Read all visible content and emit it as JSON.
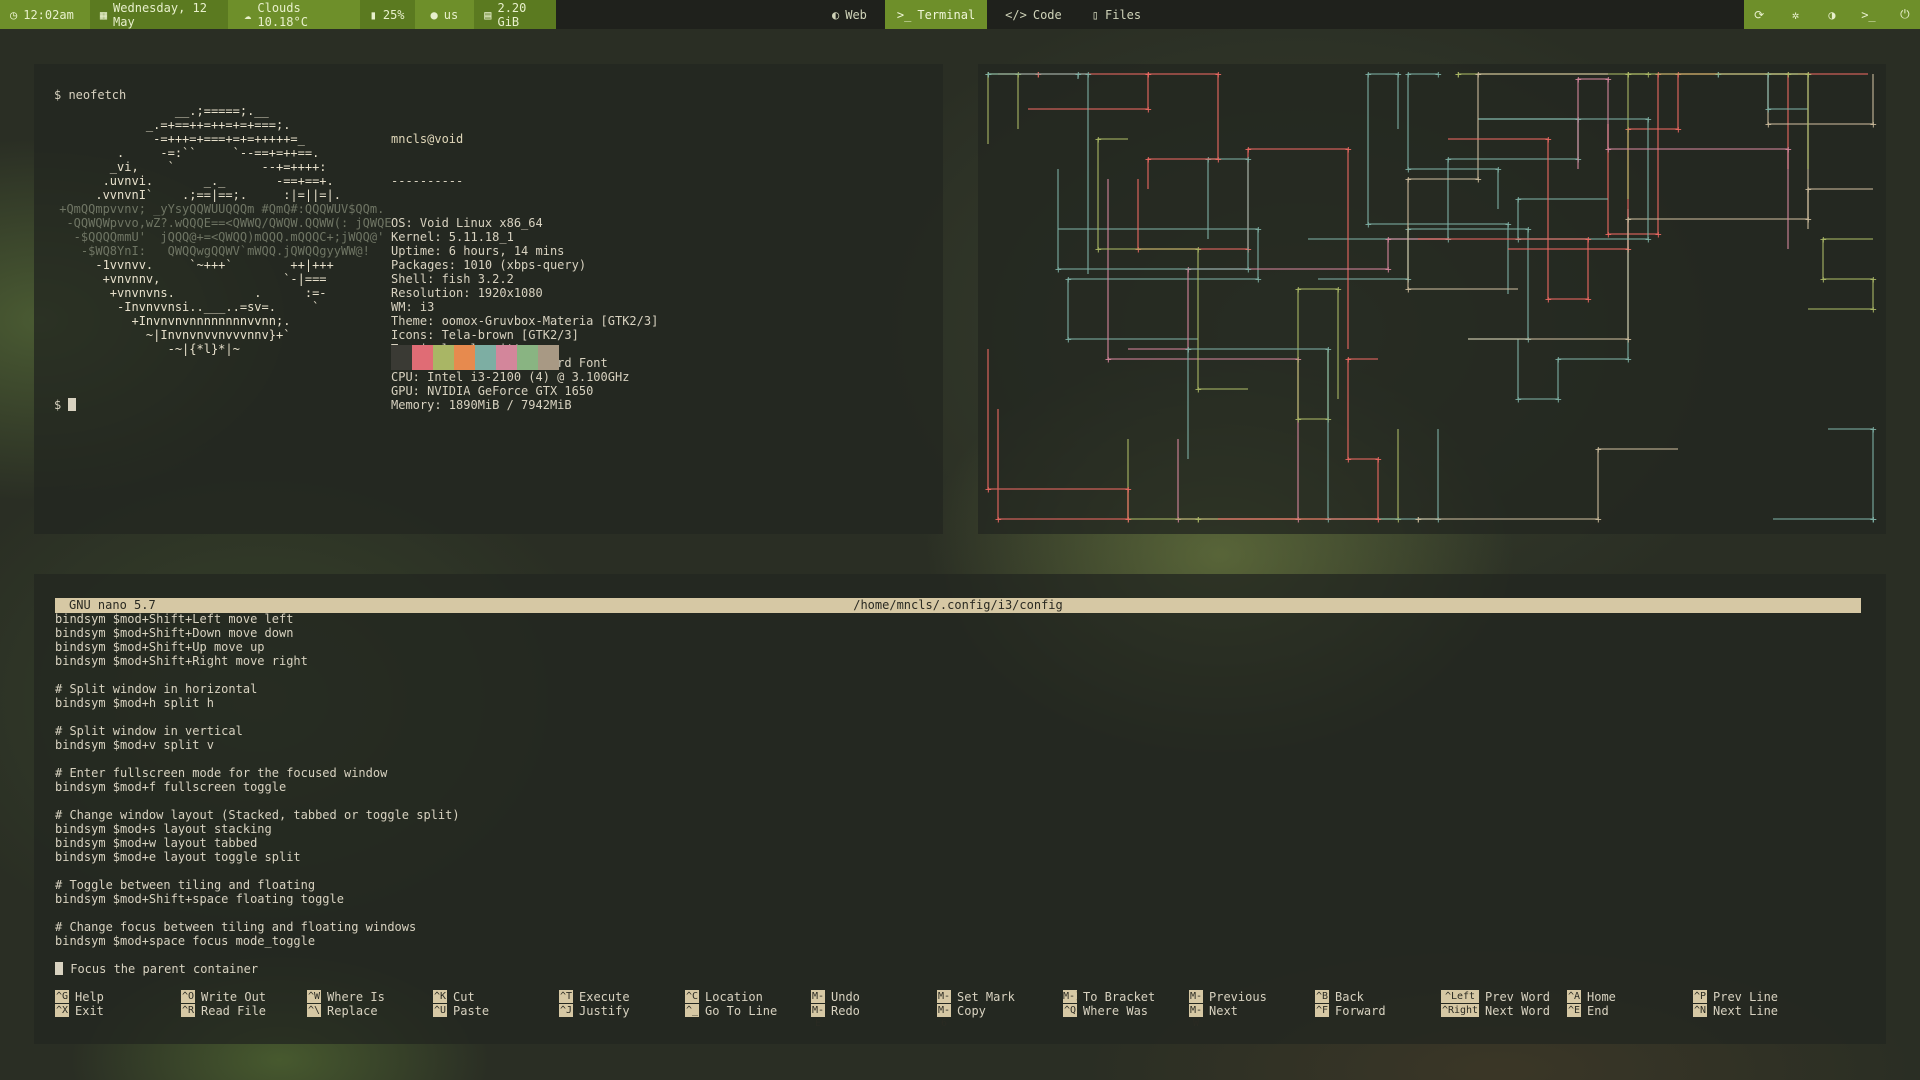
{
  "topbar": {
    "time": "12:02am",
    "date": "Wednesday, 12 May",
    "weather": "Clouds 10.18°C",
    "battery": "25%",
    "user": "us",
    "memory": "2.20 GiB",
    "workspaces": [
      {
        "label": "Web",
        "icon": "globe-icon",
        "active": false
      },
      {
        "label": "Terminal",
        "icon": "terminal-icon",
        "active": true
      },
      {
        "label": "Code",
        "icon": "code-icon",
        "active": false
      },
      {
        "label": "Files",
        "icon": "file-icon",
        "active": false
      }
    ],
    "right_icons": [
      "refresh-icon",
      "gear-icon",
      "theme-icon",
      "terminal-icon",
      "power-icon"
    ],
    "accent": "#6e8f2a"
  },
  "neofetch": {
    "prompt": "$ neofetch",
    "ascii": [
      "                 __.;=====;.__",
      "             _.=+==++=++=+=+===;.",
      "              -=+++=+===+=+=+++++=_",
      "         .     -=:``     `--==+=++==.",
      "        _vi,    `            --+=++++:",
      "       .uvnvi.       _._       -==+==+.",
      "      .vvnvnI`    .;==|==;.     :|=||=|.",
      " +QmQQmpvvnv; _yYsyQQWUUQQQm #QmQ#:QQQWUV$QQm.",
      "  -QQWQWpvvo,wZ?.wQQQE==<QWWQ/QWQW.QQWW(: jQWQE",
      "   -$QQQQmmU'  jQQQ@+=<QWQQ)mQQQ.mQQQC+;jWQQ@'",
      "    -$WQ8YnI:   QWQQwgQQWV`mWQQ.jQWQQgyyWW@!",
      "      -1vvnvv.     `~+++`        ++|+++",
      "       +vnvnnv,                 `-|===",
      "        +vnvnvns.           .      :=-",
      "         -Invnvvnsi..___..=sv=.     `",
      "           +Invnvnvnnnnnnnnvvnn;.",
      "             ~|Invnvnvvnvvvnnv}+`",
      "                -~|{*l}*|~"
    ],
    "ascii_dim_rows": [
      7,
      8,
      9,
      10
    ],
    "user_host": "mncls@void",
    "separator": "----------",
    "info": [
      "OS: Void Linux x86_64",
      "Kernel: 5.11.18_1",
      "Uptime: 6 hours, 14 mins",
      "Packages: 1010 (xbps-query)",
      "Shell: fish 3.2.2",
      "Resolution: 1920x1080",
      "WM: i3",
      "Theme: oomox-Gruvbox-Materia [GTK2/3]",
      "Icons: Tela-brown [GTK2/3]",
      "Terminal: alacritty",
      "Terminal Font: agave Nerd Font",
      "CPU: Intel i3-2100 (4) @ 3.100GHz",
      "GPU: NVIDIA GeForce GTX 1650",
      "Memory: 1890MiB / 7942MiB"
    ],
    "palette": [
      "#3a3a34",
      "#e06c75",
      "#a9b665",
      "#e78a4e",
      "#7daea3",
      "#d3869b",
      "#89b482",
      "#a89984"
    ],
    "prompt2": "$"
  },
  "pipes": {
    "colors": [
      "#ea6962",
      "#a9b665",
      "#7daea3",
      "#d3869b",
      "#c9b99a"
    ]
  },
  "nano": {
    "version": "GNU nano 5.7",
    "path": "/home/mncls/.config/i3/config",
    "lines": [
      "bindsym $mod+Shift+Left move left",
      "bindsym $mod+Shift+Down move down",
      "bindsym $mod+Shift+Up move up",
      "bindsym $mod+Shift+Right move right",
      "",
      "# Split window in horizontal",
      "bindsym $mod+h split h",
      "",
      "# Split window in vertical",
      "bindsym $mod+v split v",
      "",
      "# Enter fullscreen mode for the focused window",
      "bindsym $mod+f fullscreen toggle",
      "",
      "# Change window layout (Stacked, tabbed or toggle split)",
      "bindsym $mod+s layout stacking",
      "bindsym $mod+w layout tabbed",
      "bindsym $mod+e layout toggle split",
      "",
      "# Toggle between tiling and floating",
      "bindsym $mod+Shift+space floating toggle",
      "",
      "# Change focus between tiling and floating windows",
      "bindsym $mod+space focus mode_toggle",
      ""
    ],
    "cursor_line": "Focus the parent container",
    "shortcuts": [
      {
        "k1": "^G",
        "l1": "Help",
        "k2": "^X",
        "l2": "Exit"
      },
      {
        "k1": "^O",
        "l1": "Write Out",
        "k2": "^R",
        "l2": "Read File"
      },
      {
        "k1": "^W",
        "l1": "Where Is",
        "k2": "^\\",
        "l2": "Replace"
      },
      {
        "k1": "^K",
        "l1": "Cut",
        "k2": "^U",
        "l2": "Paste"
      },
      {
        "k1": "^T",
        "l1": "Execute",
        "k2": "^J",
        "l2": "Justify"
      },
      {
        "k1": "^C",
        "l1": "Location",
        "k2": "^_",
        "l2": "Go To Line"
      },
      {
        "k1": "M-U",
        "l1": "Undo",
        "k2": "M-E",
        "l2": "Redo"
      },
      {
        "k1": "M-A",
        "l1": "Set Mark",
        "k2": "M-6",
        "l2": "Copy"
      },
      {
        "k1": "M-]",
        "l1": "To Bracket",
        "k2": "^Q",
        "l2": "Where Was"
      },
      {
        "k1": "M-Q",
        "l1": "Previous",
        "k2": "M-W",
        "l2": "Next"
      },
      {
        "k1": "^B",
        "l1": "Back",
        "k2": "^F",
        "l2": "Forward"
      },
      {
        "k1": "^Left",
        "l1": "Prev Word",
        "k2": "^Right",
        "l2": "Next Word"
      },
      {
        "k1": "^A",
        "l1": "Home",
        "k2": "^E",
        "l2": "End"
      },
      {
        "k1": "^P",
        "l1": "Prev Line",
        "k2": "^N",
        "l2": "Next Line"
      }
    ]
  }
}
